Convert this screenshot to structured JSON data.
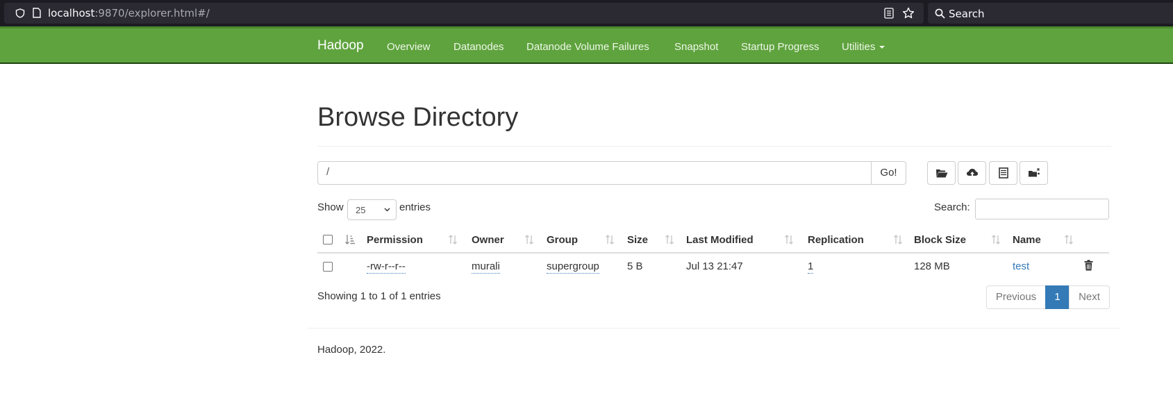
{
  "browser": {
    "url_host": "localhost",
    "url_rest": ":9870/explorer.html#/",
    "search_placeholder": "Search",
    "icons": [
      "shield-icon",
      "page-icon",
      "reader-view-icon",
      "bookmark-star-icon",
      "search-icon"
    ]
  },
  "navbar": {
    "brand": "Hadoop",
    "items": [
      {
        "label": "Overview"
      },
      {
        "label": "Datanodes"
      },
      {
        "label": "Datanode Volume Failures"
      },
      {
        "label": "Snapshot"
      },
      {
        "label": "Startup Progress"
      },
      {
        "label": "Utilities"
      }
    ],
    "color": "#5fa33e"
  },
  "page": {
    "title": "Browse Directory"
  },
  "path_bar": {
    "value": "/",
    "go_label": "Go!",
    "tool_icons": [
      "folder-open-icon",
      "cloud-upload-icon",
      "list-alt-icon",
      "folder-cut-icon"
    ]
  },
  "table_controls": {
    "show_label": "Show",
    "page_length": "25",
    "entries_label": "entries",
    "search_label": "Search:"
  },
  "table": {
    "columns": [
      "Permission",
      "Owner",
      "Group",
      "Size",
      "Last Modified",
      "Replication",
      "Block Size",
      "Name"
    ],
    "rows": [
      {
        "permission": "-rw-r--r--",
        "owner": "murali",
        "group": "supergroup",
        "size": "5 B",
        "last_modified": "Jul 13 21:47",
        "replication": "1",
        "block_size": "128 MB",
        "name": "test"
      }
    ]
  },
  "pagination": {
    "info": "Showing 1 to 1 of 1 entries",
    "previous": "Previous",
    "current": "1",
    "next": "Next",
    "accent": "#337ab7"
  },
  "footer": {
    "text": "Hadoop, 2022."
  }
}
